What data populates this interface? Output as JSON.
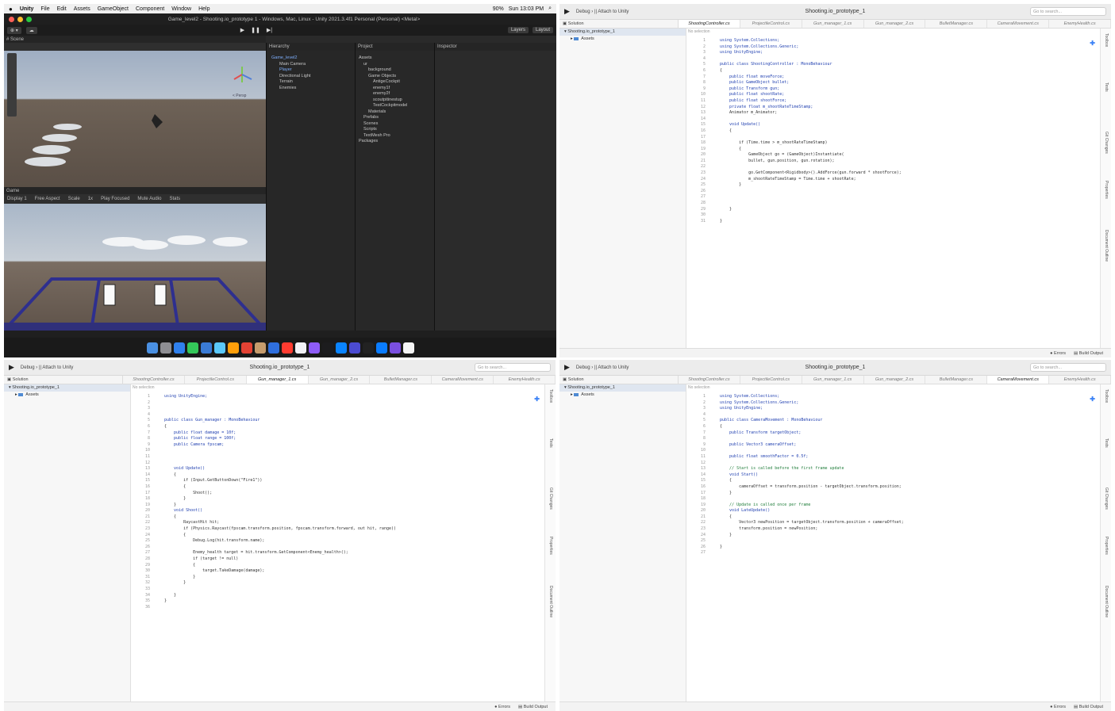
{
  "unity": {
    "menubar": {
      "app": "Unity",
      "items": [
        "File",
        "Edit",
        "Assets",
        "GameObject",
        "Component",
        "Window",
        "Help"
      ],
      "clock": "Sun 13:03 PM",
      "battery": "90%"
    },
    "window_title": "Game_level2 - Shooting.io_prototype 1 - Windows, Mac, Linux - Unity 2021.3.4f1 Personal (Personal) <Metal>",
    "toolbar": {
      "layers": "Layers",
      "layout": "Layout"
    },
    "scene_tab": "# Scene",
    "hierarchy_tab": "Hierarchy",
    "project_tab": "Project",
    "inspector_tab": "Inspector",
    "game_tab": "Game",
    "game_bar": {
      "display": "Display 1",
      "aspect": "Free Aspect",
      "scale": "Scale",
      "scale_value": "1x",
      "play_focused": "Play Focused",
      "mute": "Mute Audio",
      "stats": "Stats"
    },
    "scene_persp": "< Persp",
    "hierarchy": [
      "Game_level2",
      "Main Camera",
      "Player",
      "Directional Light",
      "Terrain",
      "Enemies"
    ],
    "project": [
      "Assets",
      "ur",
      "background",
      "Game Objects",
      "AntigeCockpit",
      "enemy1f",
      "enemy2f",
      "scoutpitinestup",
      "TestCockpitmodel",
      "Materials",
      "Prefabs",
      "Scenes",
      "Scripts",
      "TextMesh Pro",
      "Packages"
    ]
  },
  "ide": {
    "run_config": "Debug",
    "run_target": "Attach to Unity",
    "project_title": "Shooting.io_prototype_1",
    "search_placeholder": "Go to search...",
    "solution_label": "Solution",
    "no_selection": "No selection",
    "solution_root": "Shooting.io_prototype_1",
    "assets_folder": "Assets",
    "tabs": [
      "ShootingController.cs",
      "ProjectileControl.cs",
      "Gun_manager_1.cs",
      "Gun_manager_2.cs",
      "BulletManager.cs",
      "CameraMovement.cs",
      "EnemyHealth.cs"
    ],
    "errors": "Errors",
    "build_output": "Build Output",
    "rail": [
      "Toolbox",
      "Tests",
      "Git Changes",
      "Properties",
      "Document Outline"
    ]
  },
  "editors": {
    "shooting": {
      "active_tab": 0,
      "lines": [
        "using System.Collections;",
        "using System.Collections.Generic;",
        "using UnityEngine;",
        "",
        "public class ShootingController : MonoBehaviour",
        "{",
        "    public float moveForce;",
        "    public GameObject bullet;",
        "    public Transform gun;",
        "    public float shootRate;",
        "    public float shootForce;",
        "    private float m_shootRateTimeStamp;",
        "    Animator m_Animator;",
        "",
        "    void Update()",
        "    {",
        "",
        "        if (Time.time > m_shootRateTimeStamp)",
        "        {",
        "            GameObject go = (GameObject)Instantiate(",
        "            bullet, gun.position, gun.rotation);",
        "",
        "            go.GetComponent<Rigidbody>().AddForce(gun.forward * shootForce);",
        "            m_shootRateTimeStamp = Time.time + shootRate;",
        "        }",
        "",
        "",
        "",
        "    }",
        "",
        "}"
      ]
    },
    "gun": {
      "active_tab": 2,
      "lines": [
        "using UnityEngine;",
        "",
        "",
        "",
        "public class Gun_manager : MonoBehaviour",
        "{",
        "    public float damage = 10f;",
        "    public float range = 100f;",
        "    public Camera fpscam;",
        "",
        "",
        "",
        "    void Update()",
        "    {",
        "        if (Input.GetButtonDown(\"Fire1\"))",
        "        {",
        "            Shoot();",
        "        }",
        "    }",
        "    void Shoot()",
        "    {",
        "        RaycastHit hit;",
        "        if (Physics.Raycast(fpscam.transform.position, fpscam.transform.forward, out hit, range))",
        "        {",
        "            Debug.Log(hit.transform.name);",
        "",
        "            Enemy_health target = hit.transform.GetComponent<Enemy_health>();",
        "            if (target != null)",
        "            {",
        "                target.TakeDamage(damage);",
        "            }",
        "        }",
        "",
        "    }",
        "}",
        ""
      ]
    },
    "camera": {
      "active_tab": 5,
      "lines": [
        "using System.Collections;",
        "using System.Collections.Generic;",
        "using UnityEngine;",
        "",
        "public class CameraMovement : MonoBehaviour",
        "{",
        "    public Transform targetObject;",
        "",
        "    public Vector3 cameraOffset;",
        "",
        "    public float smoothFactor = 0.5f;",
        "",
        "    // Start is called before the first frame update",
        "    void Start()",
        "    {",
        "        cameraOffset = transform.position - targetObject.transform.position;",
        "    }",
        "",
        "    // Update is called once per frame",
        "    void LateUpdate()",
        "    {",
        "        Vector3 newPosition = targetObject.transform.position + cameraOffset;",
        "        transform.position = newPosition;",
        "    }",
        "",
        "}",
        ""
      ]
    }
  }
}
